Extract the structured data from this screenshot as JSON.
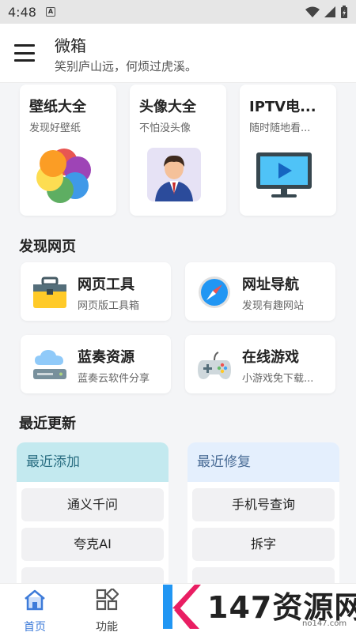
{
  "status": {
    "time": "4:48",
    "notification_letter": "A"
  },
  "app": {
    "title": "微箱",
    "subtitle": "笑别庐山远，何烦过虎溪。"
  },
  "top_cards": [
    {
      "title": "壁纸大全",
      "subtitle": "发现好壁纸",
      "icon": "photos-flower-icon"
    },
    {
      "title": "头像大全",
      "subtitle": "不怕没头像",
      "icon": "avatar-person-icon"
    },
    {
      "title": "IPTV电...",
      "subtitle": "随时随地看...",
      "icon": "tv-play-icon"
    }
  ],
  "sections": {
    "discover": "发现网页",
    "recent": "最近更新"
  },
  "web_cards": [
    {
      "title": "网页工具",
      "subtitle": "网页版工具箱",
      "icon": "toolbox-icon"
    },
    {
      "title": "网址导航",
      "subtitle": "发现有趣网站",
      "icon": "compass-icon"
    },
    {
      "title": "蓝奏资源",
      "subtitle": "蓝奏云软件分享",
      "icon": "cloud-server-icon"
    },
    {
      "title": "在线游戏",
      "subtitle": "小游戏免下载...",
      "icon": "gamepad-icon"
    }
  ],
  "recent": {
    "added": {
      "title": "最近添加",
      "items": [
        "通义千问",
        "夸克AI"
      ]
    },
    "fixed": {
      "title": "最近修复",
      "items": [
        "手机号查询",
        "拆字"
      ]
    }
  },
  "nav": {
    "home": "首页",
    "functions": "功能"
  },
  "watermark": {
    "text": "147资源网",
    "url": "no147.com"
  },
  "colors": {
    "accent": "#3d7bd9",
    "added_header": "#c3e9ef",
    "fixed_header": "#e4effd"
  }
}
